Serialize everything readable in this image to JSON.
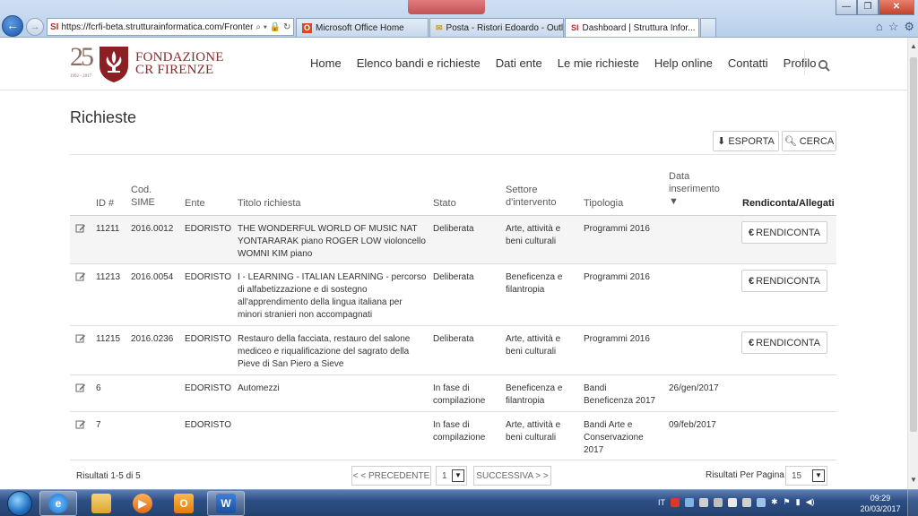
{
  "browser": {
    "url": "https://fcrfi-beta.strutturainformatica.com/Fronter",
    "favicon_text": "SI",
    "tabs": [
      {
        "label": "Microsoft Office Home"
      },
      {
        "label": "Posta - Ristori Edoardo - Outlo..."
      },
      {
        "label": "Dashboard | Struttura Infor...",
        "active": true
      }
    ]
  },
  "logo": {
    "number": "25",
    "years": "1992 - 2017",
    "line1": "FONDAZIONE",
    "line2": "CR FIRENZE"
  },
  "nav": [
    "Home",
    "Elenco bandi e richieste",
    "Dati ente",
    "Le mie richieste",
    "Help online",
    "Contatti",
    "Profilo"
  ],
  "page": {
    "title": "Richieste",
    "export_label": "ESPORTA",
    "search_label": "CERCA"
  },
  "table": {
    "headers": {
      "id": "ID #",
      "sime_1": "Cod.",
      "sime_2": "SIME",
      "ente": "Ente",
      "titolo": "Titolo richiesta",
      "stato": "Stato",
      "settore_1": "Settore",
      "settore_2": "d'intervento",
      "tipologia": "Tipologia",
      "data_1": "Data",
      "data_2": "inserimento",
      "sort": "▼",
      "rendiconta": "Rendiconta/Allegati"
    },
    "rendiconta_label": "RENDICONTA",
    "currency_symbol": "€",
    "rows": [
      {
        "id": "11211",
        "sime": "2016.0012",
        "ente": "EDORISTO",
        "titolo": [
          "THE WONDERFUL WORLD OF MUSIC NAT",
          "YONTARARAK piano ROGER LOW violoncello",
          "WOMNI KIM piano"
        ],
        "stato": [
          "Deliberata"
        ],
        "settore": [
          "Arte, attività e",
          "beni culturali"
        ],
        "tipologia": [
          "Programmi 2016"
        ],
        "data": "",
        "rendiconta": true
      },
      {
        "id": "11213",
        "sime": "2016.0054",
        "ente": "EDORISTO",
        "titolo": [
          "I - LEARNING - ITALIAN LEARNING - percorso",
          "di alfabetizzazione e di sostegno",
          "all'apprendimento della lingua italiana per",
          "minori stranieri non accompagnati"
        ],
        "stato": [
          "Deliberata"
        ],
        "settore": [
          "Beneficenza e",
          "filantropia"
        ],
        "tipologia": [
          "Programmi 2016"
        ],
        "data": "",
        "rendiconta": true
      },
      {
        "id": "11215",
        "sime": "2016.0236",
        "ente": "EDORISTO",
        "titolo": [
          "Restauro della facciata, restauro del salone",
          "mediceo e riqualificazione del sagrato della",
          "Pieve di San Piero a Sieve"
        ],
        "stato": [
          "Deliberata"
        ],
        "settore": [
          "Arte, attività e",
          "beni culturali"
        ],
        "tipologia": [
          "Programmi 2016"
        ],
        "data": "",
        "rendiconta": true
      },
      {
        "id": "6",
        "sime": "",
        "ente": "EDORISTO",
        "titolo": [
          "Automezzi"
        ],
        "stato": [
          "In fase di",
          "compilazione"
        ],
        "settore": [
          "Beneficenza e",
          "filantropia"
        ],
        "tipologia": [
          "Bandi",
          "Beneficenza 2017"
        ],
        "data": "26/gen/2017",
        "rendiconta": false
      },
      {
        "id": "7",
        "sime": "",
        "ente": "EDORISTO",
        "titolo": [],
        "stato": [
          "In fase di",
          "compilazione"
        ],
        "settore": [
          "Arte, attività e",
          "beni culturali"
        ],
        "tipologia": [
          "Bandi Arte e",
          "Conservazione",
          "2017"
        ],
        "data": "09/feb/2017",
        "rendiconta": false
      }
    ]
  },
  "pagination": {
    "results_text": "Risultati 1-5 di 5",
    "prev_label": "< < PRECEDENTE",
    "page_value": "1",
    "next_label": "SUCCESSIVA > >",
    "per_page_label": "Risultati Per Pagina",
    "per_page_value": "15"
  },
  "taskbar": {
    "language": "IT",
    "time": "09:29",
    "date": "20/03/2017"
  }
}
